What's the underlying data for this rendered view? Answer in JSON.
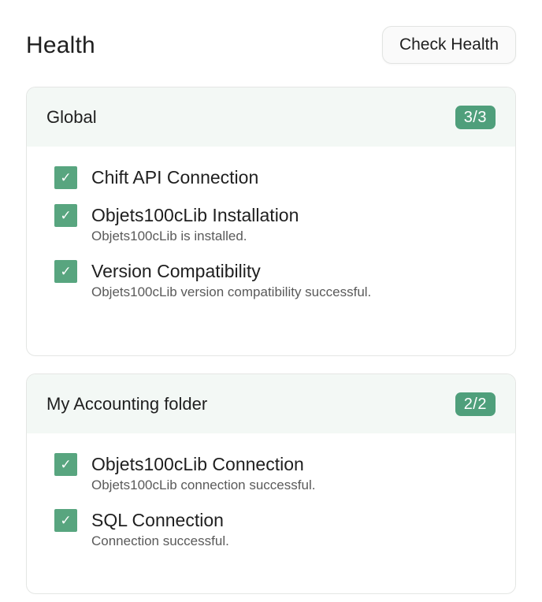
{
  "header": {
    "title": "Health",
    "check_button": "Check Health"
  },
  "sections": [
    {
      "title": "Global",
      "badge": "3/3",
      "items": [
        {
          "title": "Chift API Connection",
          "subtitle": ""
        },
        {
          "title": "Objets100cLib Installation",
          "subtitle": "Objets100cLib is installed."
        },
        {
          "title": "Version Compatibility",
          "subtitle": "Objets100cLib version compatibility successful."
        }
      ]
    },
    {
      "title": "My Accounting folder",
      "badge": "2/2",
      "items": [
        {
          "title": "Objets100cLib Connection",
          "subtitle": "Objets100cLib connection successful."
        },
        {
          "title": "SQL Connection",
          "subtitle": "Connection successful."
        }
      ]
    }
  ],
  "icons": {
    "check": "check-icon"
  },
  "colors": {
    "accent": "#4f9f7b",
    "check": "#58a57f",
    "header_bg": "#f3f8f5"
  }
}
